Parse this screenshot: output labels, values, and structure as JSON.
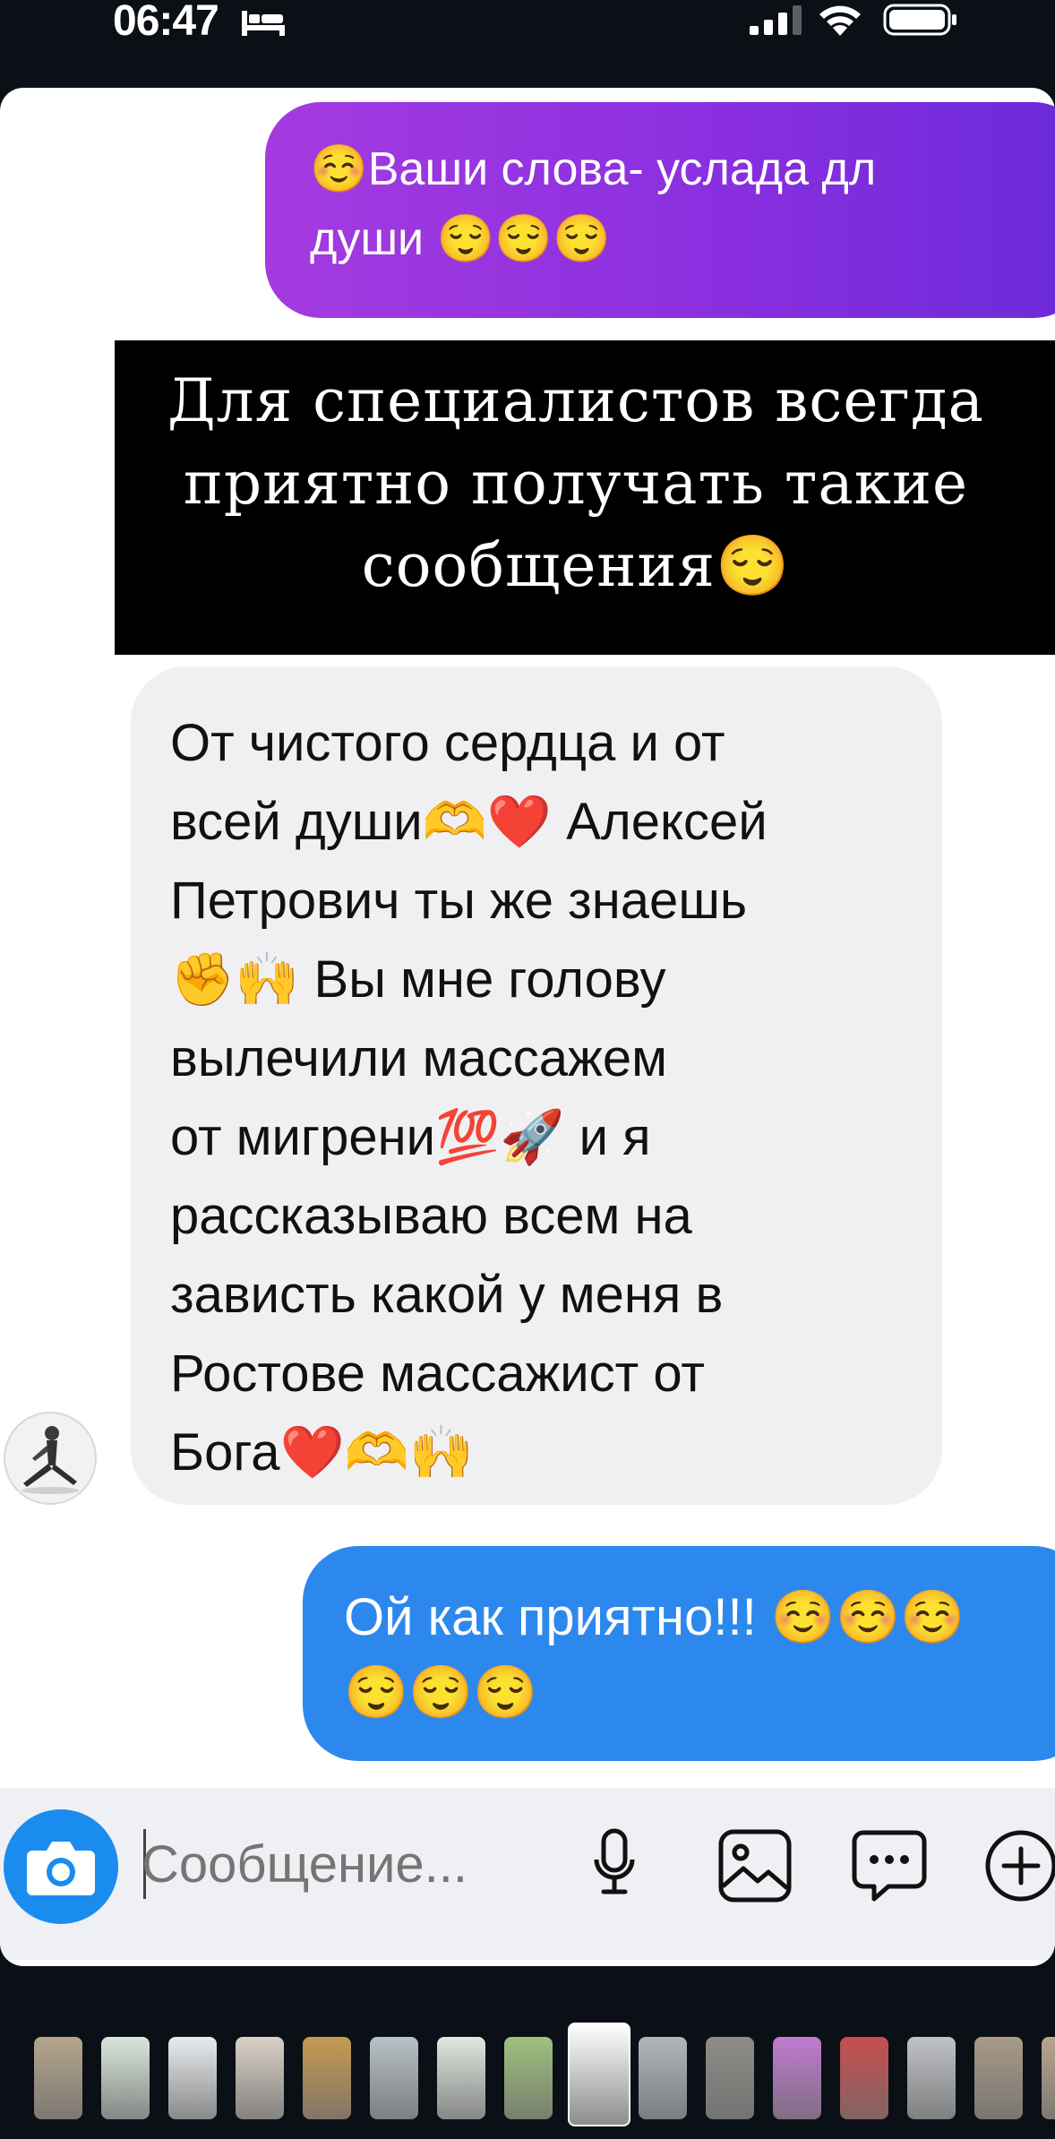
{
  "status_bar": {
    "time": "06:47"
  },
  "messages": {
    "outgoing_1": {
      "line1": "☺️Ваши слова- услада дл",
      "line2": "души 😌😌😌"
    },
    "overlay_caption": {
      "line1": "Для специалистов всегда",
      "line2": "приятно получать такие",
      "line3": "сообщения😌"
    },
    "incoming_1": {
      "lines": [
        "От чистого сердца и от",
        "всей души🫶❤️ Алексей",
        "Петрович ты же знаешь",
        "✊🙌 Вы мне голову",
        "вылечили массажем",
        "от мигрени💯🚀 и я",
        "рассказываю всем на",
        "зависть какой у меня в",
        "Ростове массажист от",
        "Бога❤️🫶🙌"
      ]
    },
    "outgoing_2": {
      "line1": "Ой как приятно!!! ☺️☺️☺️",
      "line2": "😌😌😌"
    }
  },
  "composer": {
    "placeholder": "Сообщение..."
  },
  "colors": {
    "purple_bubble": "#8a2fe0",
    "blue_bubble": "#2d88ee",
    "incoming_bubble": "#f0f0f2",
    "camera_button": "#1a8cf0"
  },
  "icons": [
    "bed-icon",
    "signal-icon",
    "wifi-icon",
    "battery-icon",
    "camera-icon",
    "microphone-icon",
    "gallery-icon",
    "sticker-chat-icon",
    "plus-circle-icon"
  ],
  "story_thumbnails": [
    "#b5a58c",
    "#d9e6dc",
    "#e9ecef",
    "#d8d0c4",
    "#c69a52",
    "#b7c1c6",
    "#dfe7df",
    "#9fc07e",
    "#ffffff",
    "#b0b7bc",
    "#8e8c87",
    "#c07ad0",
    "#c94d4d",
    "#c0c2c6",
    "#a89a86",
    "#b9a48e"
  ]
}
